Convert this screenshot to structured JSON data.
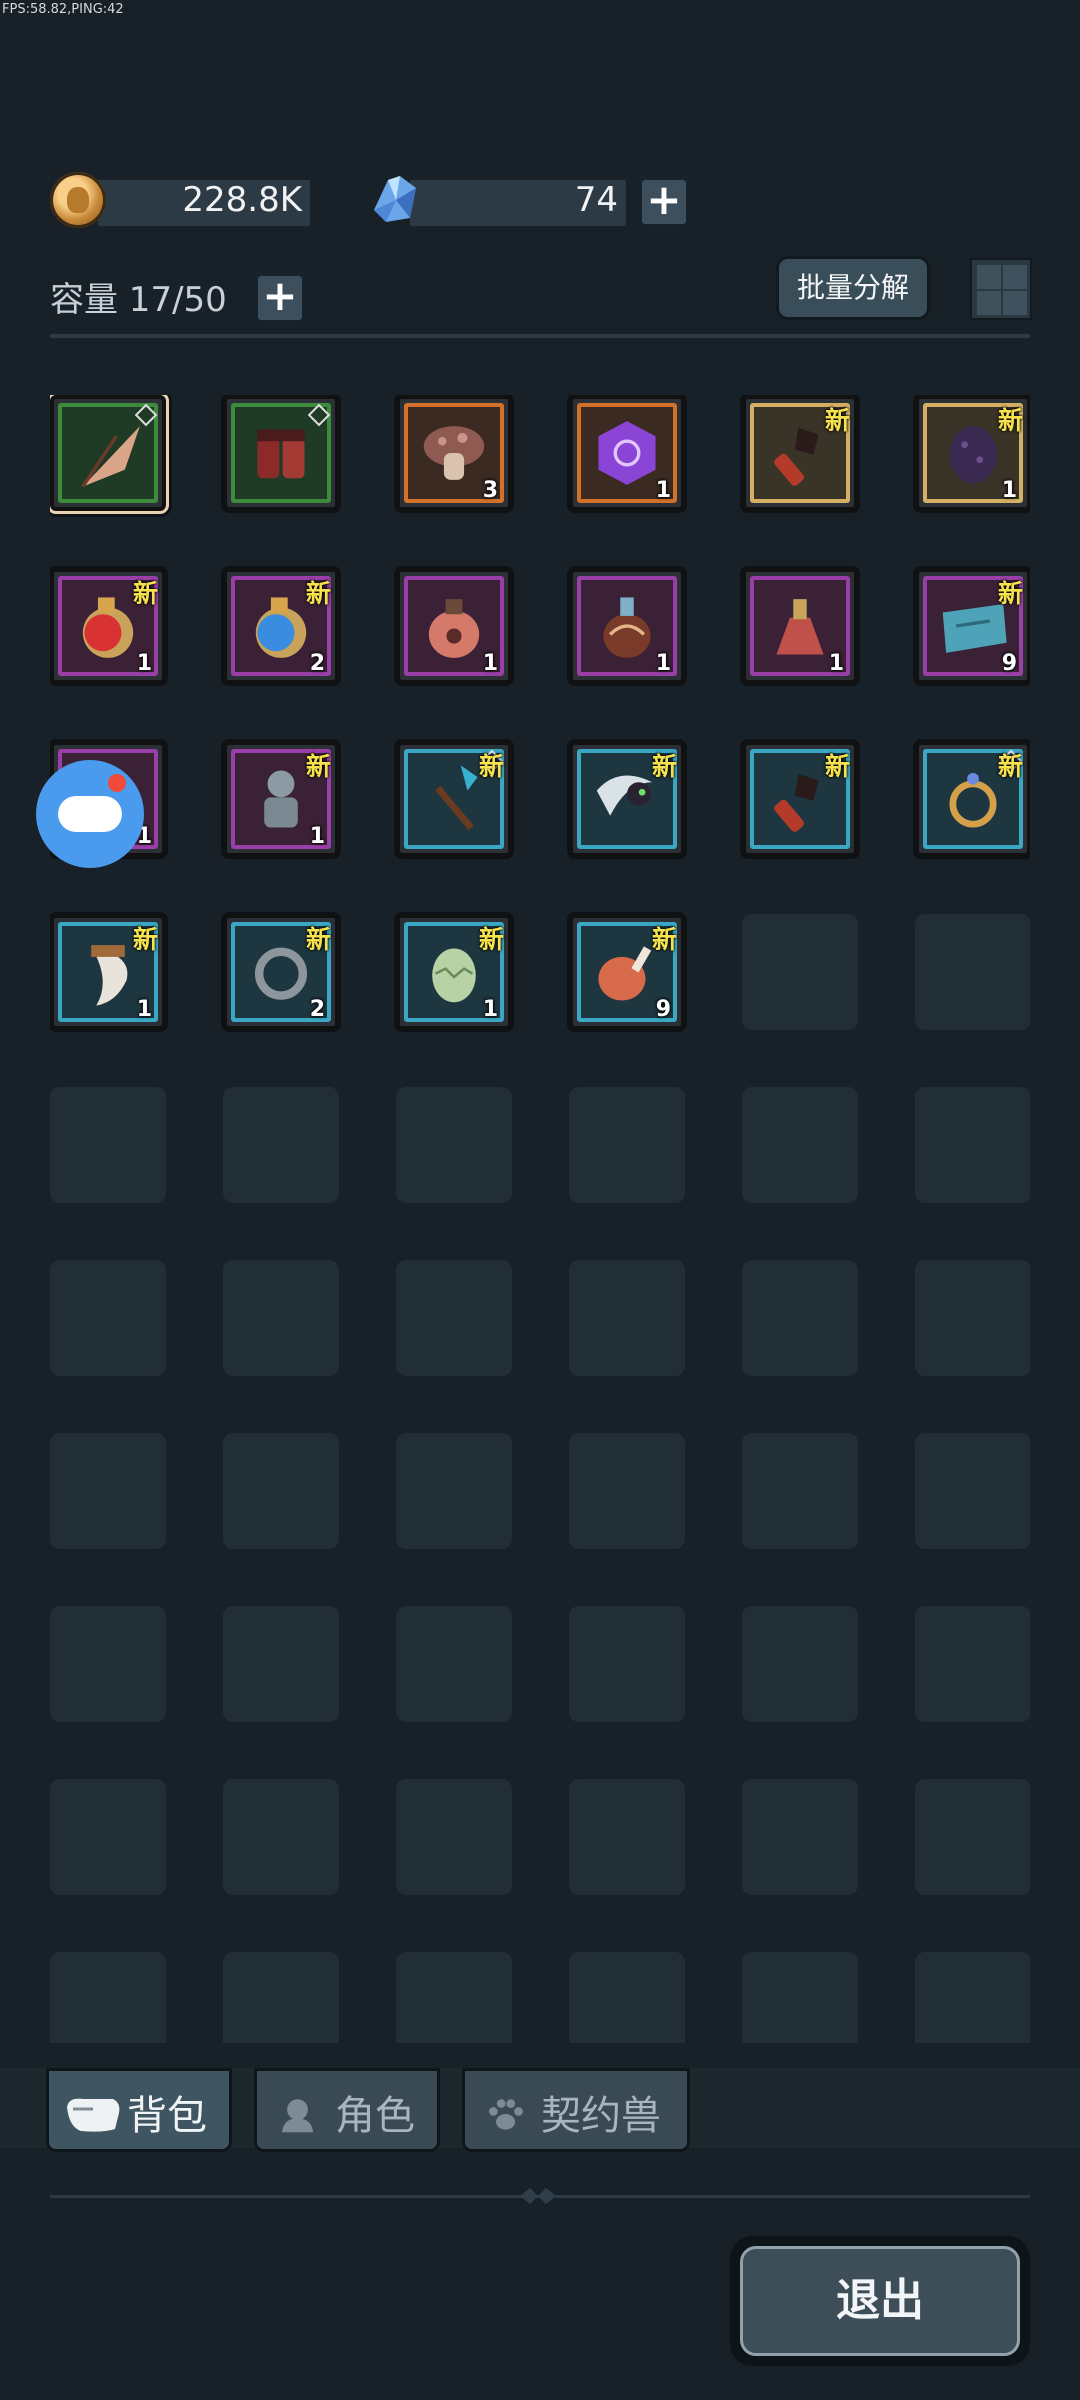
{
  "debug": {
    "fps_text": "FPS:58.82,PING:42"
  },
  "currency": {
    "gold": {
      "value": "228.8K",
      "icon": "gold-coin-icon"
    },
    "gems": {
      "value": "74",
      "icon": "crystal-icon"
    },
    "add_label": "+"
  },
  "capacity": {
    "label": "容量 17/50",
    "add_label": "+"
  },
  "toolbar": {
    "batch_decompose": "批量分解",
    "layout_icon": "grid-view-icon"
  },
  "new_tag": "新",
  "items": [
    {
      "name": "feather-blade",
      "rarity": "green",
      "count": "",
      "new": false,
      "locked": true,
      "selected": true
    },
    {
      "name": "red-boots",
      "rarity": "green",
      "count": "",
      "new": false,
      "locked": true
    },
    {
      "name": "mushroom",
      "rarity": "orange",
      "count": "3",
      "new": false
    },
    {
      "name": "purple-rune-stone",
      "rarity": "orange",
      "count": "1",
      "new": false
    },
    {
      "name": "red-torch",
      "rarity": "gold",
      "count": "",
      "new": true
    },
    {
      "name": "spiked-egg",
      "rarity": "gold",
      "count": "1",
      "new": true
    },
    {
      "name": "red-potion",
      "rarity": "purple",
      "count": "1",
      "new": true
    },
    {
      "name": "blue-potion",
      "rarity": "purple",
      "count": "2",
      "new": true
    },
    {
      "name": "paw-jar",
      "rarity": "purple",
      "count": "1",
      "new": false
    },
    {
      "name": "ornate-flask",
      "rarity": "purple",
      "count": "1",
      "new": false
    },
    {
      "name": "red-vial",
      "rarity": "purple",
      "count": "1",
      "new": false
    },
    {
      "name": "treasure-map",
      "rarity": "purple",
      "count": "9",
      "new": true
    },
    {
      "name": "potion-partial",
      "rarity": "purple",
      "count": "1",
      "new": false
    },
    {
      "name": "stone-bust",
      "rarity": "purple",
      "count": "1",
      "new": true
    },
    {
      "name": "crystal-staff",
      "rarity": "cyan",
      "count": "",
      "new": true,
      "locked": true
    },
    {
      "name": "cat-scythe",
      "rarity": "cyan",
      "count": "",
      "new": true
    },
    {
      "name": "red-torch-2",
      "rarity": "cyan",
      "count": "",
      "new": true
    },
    {
      "name": "gold-ring",
      "rarity": "cyan",
      "count": "",
      "new": true,
      "locked": true
    },
    {
      "name": "fang",
      "rarity": "cyan",
      "count": "1",
      "new": true
    },
    {
      "name": "iron-ring",
      "rarity": "cyan",
      "count": "2",
      "new": true
    },
    {
      "name": "green-egg",
      "rarity": "cyan",
      "count": "1",
      "new": true
    },
    {
      "name": "meat-leg",
      "rarity": "cyan",
      "count": "9",
      "new": true
    }
  ],
  "tabs": [
    {
      "label": "背包",
      "icon": "bag-icon",
      "active": true
    },
    {
      "label": "角色",
      "icon": "character-icon",
      "active": false
    },
    {
      "label": "契约兽",
      "icon": "paw-icon",
      "active": false
    }
  ],
  "exit_label": "退出",
  "colors": {
    "background": "#182128",
    "new_tag": "#f5e24c",
    "green": "#3c8c3c",
    "orange": "#d1712a",
    "gold": "#d3b063",
    "purple": "#9a3fa8",
    "cyan": "#3aa8c4"
  }
}
